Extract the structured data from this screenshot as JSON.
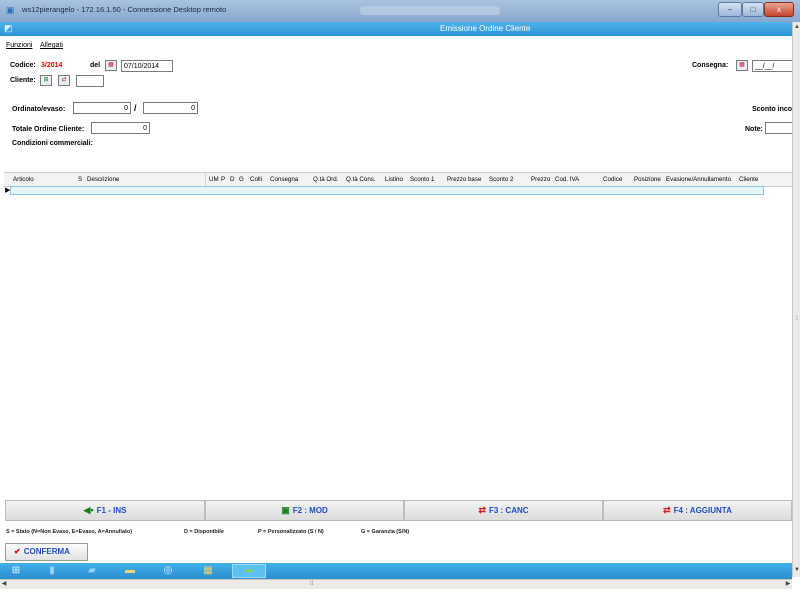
{
  "window": {
    "title": "ws12pierangelo - 172.16.1.50 - Connessione Desktop remoto",
    "app_title": "Emissione Ordine Cliente",
    "minimize": "–",
    "maximize": "□",
    "close": "x"
  },
  "menu": {
    "funzioni": "Funzioni",
    "allegati": "Allegati"
  },
  "header": {
    "codice_label": "Codice:",
    "codice_value": "3/2014",
    "del_label": "del",
    "date_value": "07/10/2014",
    "cliente_label": "Cliente:",
    "consegna_label": "Consegna:",
    "consegna_value": "__/__/",
    "ordinato_label": "Ordinato/evaso:",
    "ordinato_value": "0",
    "slash": "/",
    "evaso_value": "0",
    "sconto_label": "Sconto inco",
    "totale_label": "Totale Ordine Cliente:",
    "totale_value": "0",
    "note_label": "Note:",
    "condizioni_label": "Condizioni commerciali:"
  },
  "grid": {
    "columns": [
      "Articolo",
      "S",
      "Descrizione",
      "UM",
      "P",
      "D",
      "G",
      "Colli",
      "Consegna",
      "Q.tà Ord.",
      "Q.tà Cons.",
      "Listino",
      "Sconto 1",
      "Prezzo base",
      "Sconto 2",
      "Prezzo",
      "Cod. IVA",
      "Codice",
      "Posizione",
      "Evasione/Annullamento",
      "Cliente"
    ],
    "row_pointer": "▶"
  },
  "function_keys": [
    {
      "label": "F1 - INS",
      "icon": "◀▪"
    },
    {
      "label": "F2 : MOD",
      "icon": "▣"
    },
    {
      "label": "F3 : CANC",
      "icon": "⇄"
    },
    {
      "label": "F4 : AGGIUNTA",
      "icon": "⇄"
    }
  ],
  "legend": [
    "S = Stato (N=Non Evaso, E=Evaso, A=Annullato)",
    "D = Disponibile",
    "P = Personalizzato (S / N)",
    "G = Garanzia (S/N)"
  ],
  "confirm_label": "CONFERMA",
  "confirm_icon": "✔",
  "scroll": {
    "up": "▲",
    "down": "▼",
    "left": "◀",
    "right": "▶",
    "grip": "⁞",
    "hgrip": "⁞⁞"
  },
  "colors": {
    "app_title_bar": "#2b95d6",
    "taskbar": "#2c8fd0",
    "accent_red": "#e00000",
    "button_text": "#1d4fc2"
  }
}
